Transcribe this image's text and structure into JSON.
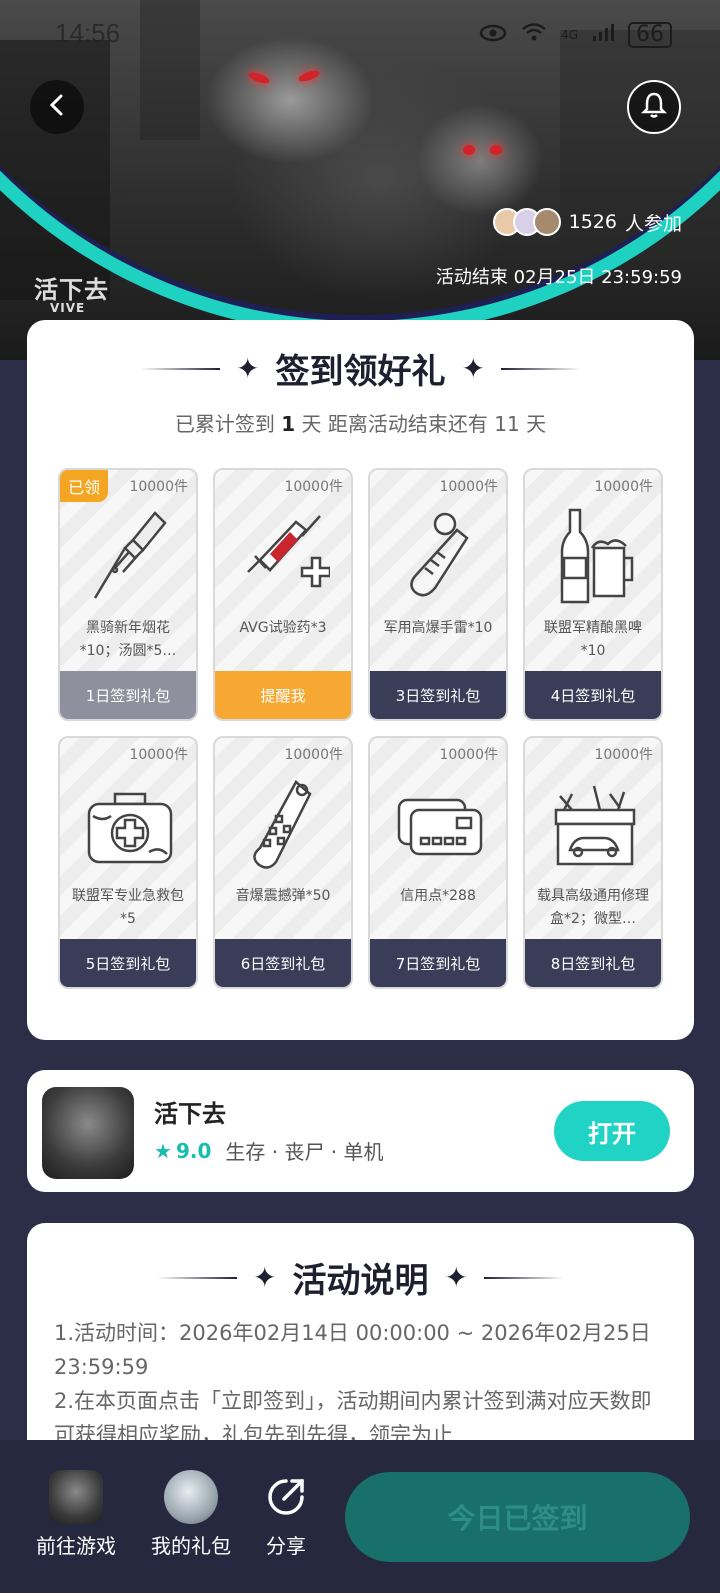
{
  "status_bar": {
    "time": "14:56",
    "battery": "66",
    "network": "4G"
  },
  "hero": {
    "participants_count": "1526",
    "participants_suffix": "人参加",
    "end_label": "活动结束 02月25日 23:59:59",
    "logo_text": "活下去",
    "logo_sub": "VIVE"
  },
  "signin": {
    "title": "签到领好礼",
    "stats_prefix": "已累计签到",
    "stats_days": "1",
    "stats_mid": "天  距离活动结束还有",
    "stats_remaining": "11",
    "stats_suffix": "天",
    "gifts": [
      {
        "qty": "10000件",
        "badge": "已领",
        "name": "黑骑新年烟花*10；汤圆*5…",
        "action": "1日签到礼包",
        "icon": "firework-icon",
        "state": "claimed"
      },
      {
        "qty": "10000件",
        "badge": "",
        "name": "AVG试验药*3",
        "action": "提醒我",
        "icon": "syringe-icon",
        "state": "remind"
      },
      {
        "qty": "10000件",
        "badge": "",
        "name": "军用高爆手雷*10",
        "action": "3日签到礼包",
        "icon": "grenade-icon",
        "state": "locked"
      },
      {
        "qty": "10000件",
        "badge": "",
        "name": "联盟军精酿黑啤*10",
        "action": "4日签到礼包",
        "icon": "beer-icon",
        "state": "locked"
      },
      {
        "qty": "10000件",
        "badge": "",
        "name": "联盟军专业急救包*5",
        "action": "5日签到礼包",
        "icon": "first-aid-kit-icon",
        "state": "locked"
      },
      {
        "qty": "10000件",
        "badge": "",
        "name": "音爆震撼弹*50",
        "action": "6日签到礼包",
        "icon": "flashbang-icon",
        "state": "locked"
      },
      {
        "qty": "10000件",
        "badge": "",
        "name": "信用点*288",
        "action": "7日签到礼包",
        "icon": "credit-card-icon",
        "state": "locked"
      },
      {
        "qty": "10000件",
        "badge": "",
        "name": "载具高级通用修理盒*2；微型…",
        "action": "8日签到礼包",
        "icon": "toolbox-icon",
        "state": "locked"
      }
    ]
  },
  "game": {
    "name": "活下去",
    "rating": "9.0",
    "tags": "生存 · 丧尸 · 单机",
    "open_label": "打开"
  },
  "description": {
    "title": "活动说明",
    "line1": "1.活动时间：2026年02月14日 00:00:00 ~ 2026年02月25日 23:59:59",
    "line2": "2.在本页面点击「立即签到」，活动期间内累计签到满对应天数即可获得相应奖励，礼包先到先得，领完为止"
  },
  "bottom_bar": {
    "go_game": "前往游戏",
    "my_gifts": "我的礼包",
    "share": "分享",
    "checked_in": "今日已签到"
  },
  "colors": {
    "accent": "#21d3c4",
    "navy": "#2c2e47",
    "orange": "#f7a833"
  }
}
